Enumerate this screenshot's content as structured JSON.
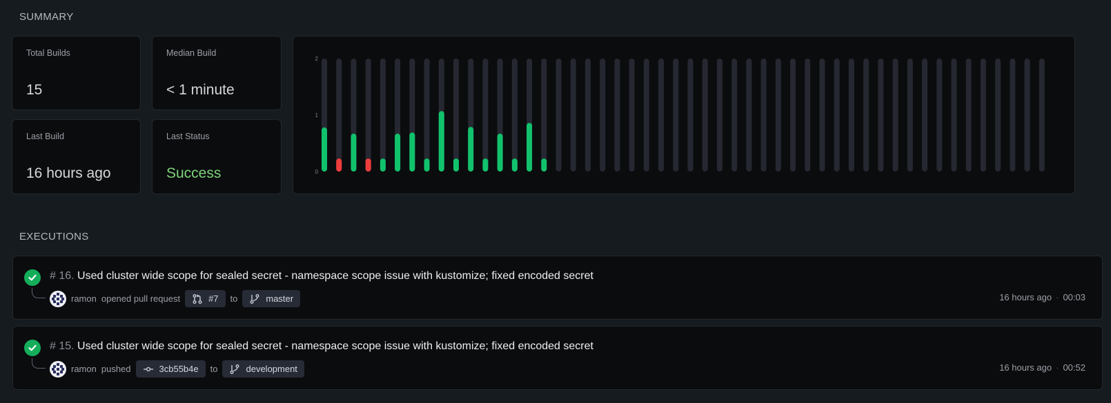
{
  "summary": {
    "title": "SUMMARY",
    "stats": {
      "total_builds": {
        "label": "Total Builds",
        "value": "15"
      },
      "median_build": {
        "label": "Median Build",
        "value": "< 1 minute"
      },
      "last_build": {
        "label": "Last Build",
        "value": "16 hours ago"
      },
      "last_status": {
        "label": "Last Status",
        "value": "Success",
        "color": "#7dd47a"
      }
    }
  },
  "chart_data": {
    "type": "bar",
    "y_ticks": [
      "0",
      "1",
      "2"
    ],
    "ylim": [
      0,
      2
    ],
    "total_slots": 50,
    "values": [
      0.78,
      0.23,
      0.67,
      0.23,
      0.23,
      0.67,
      0.69,
      0.23,
      1.07,
      0.23,
      0.79,
      0.23,
      0.67,
      0.23,
      0.86,
      0.23
    ],
    "statuses": [
      "success",
      "failure",
      "success",
      "failure",
      "success",
      "success",
      "success",
      "success",
      "success",
      "success",
      "success",
      "success",
      "success",
      "success",
      "success",
      "success"
    ],
    "colors": {
      "success": "#11c26c",
      "failure": "#ef3d3d",
      "track": "#262831"
    }
  },
  "executions": {
    "title": "EXECUTIONS",
    "items": [
      {
        "number": "# 16.",
        "message": "Used cluster wide scope for sealed secret - namespace scope issue with kustomize; fixed encoded secret",
        "author": "ramon",
        "action": "opened pull request",
        "ref_icon": "pull-request-icon",
        "ref": "#7",
        "to": "to",
        "branch": "master",
        "time": "16 hours ago",
        "duration": "00:03"
      },
      {
        "number": "# 15.",
        "message": "Used cluster wide scope for sealed secret - namespace scope issue with kustomize; fixed encoded secret",
        "author": "ramon",
        "action": "pushed",
        "ref_icon": "commit-icon",
        "ref": "3cb55b4e",
        "to": "to",
        "branch": "development",
        "time": "16 hours ago",
        "duration": "00:52"
      }
    ]
  }
}
